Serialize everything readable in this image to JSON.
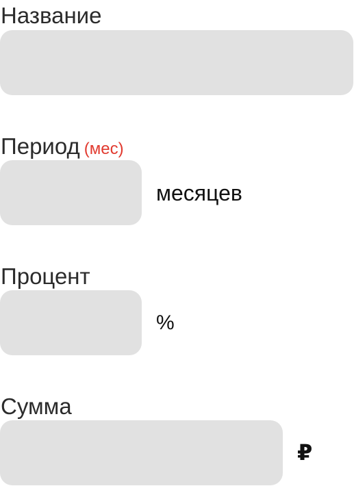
{
  "form": {
    "name": {
      "label": "Название",
      "value": ""
    },
    "period": {
      "label": "Период",
      "hint": "(мес)",
      "value": "",
      "unit": "месяцев"
    },
    "percent": {
      "label": "Процент",
      "value": "",
      "unit": "%"
    },
    "sum": {
      "label": "Сумма",
      "value": "",
      "unit": "₽"
    }
  },
  "colors": {
    "field_background": "#e1e1e1",
    "hint": "#e13a2f",
    "label": "#2b2b2b"
  }
}
